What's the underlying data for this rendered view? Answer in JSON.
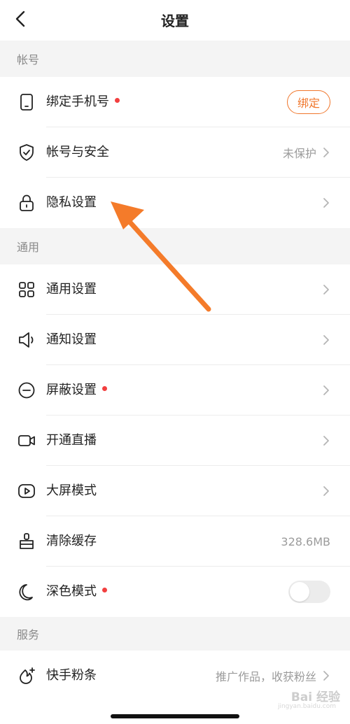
{
  "header": {
    "title": "设置"
  },
  "sections": {
    "account": {
      "title": "帐号"
    },
    "general": {
      "title": "通用"
    },
    "service": {
      "title": "服务"
    }
  },
  "rows": {
    "bind_phone": {
      "label": "绑定手机号",
      "button": "绑定",
      "has_dot": true
    },
    "account_security": {
      "label": "帐号与安全",
      "value": "未保护"
    },
    "privacy": {
      "label": "隐私设置"
    },
    "general_settings": {
      "label": "通用设置"
    },
    "notification": {
      "label": "通知设置"
    },
    "block": {
      "label": "屏蔽设置",
      "has_dot": true
    },
    "live": {
      "label": "开通直播"
    },
    "big_screen": {
      "label": "大屏模式"
    },
    "clear_cache": {
      "label": "清除缓存",
      "value": "328.6MB"
    },
    "dark_mode": {
      "label": "深色模式",
      "has_dot": true,
      "toggle_on": false
    },
    "kuaishou_fans": {
      "label": "快手粉条",
      "value": "推广作品，收获粉丝"
    }
  },
  "watermark": {
    "text": "Bai 经验",
    "sub": "jingyan.baidu.com"
  },
  "colors": {
    "accent": "#f0762b",
    "dot": "#f23f3f",
    "arrow": "#f47b2a"
  },
  "icons": {
    "back": "chevron-left-icon",
    "phone": "phone-icon",
    "shield": "shield-check-icon",
    "lock": "lock-icon",
    "grid": "grid-icon",
    "speaker": "speaker-icon",
    "block": "minus-circle-icon",
    "video": "video-camera-icon",
    "play": "play-screen-icon",
    "broom": "broom-icon",
    "moon": "moon-icon",
    "sparkle": "sparkle-fire-icon"
  }
}
